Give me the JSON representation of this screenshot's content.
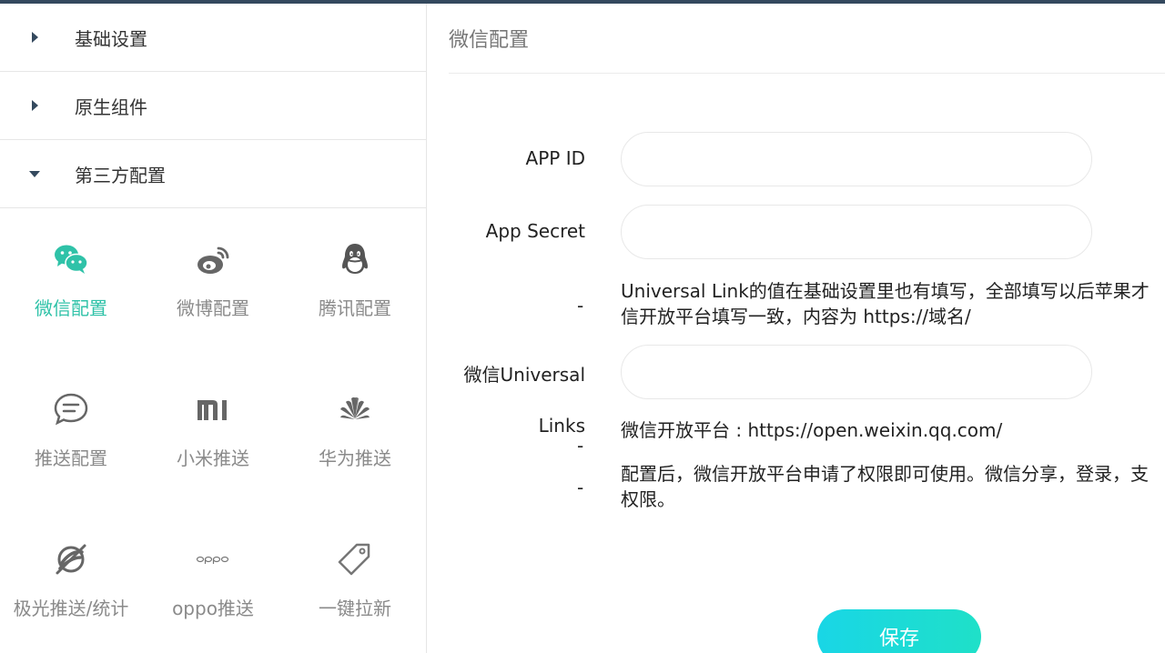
{
  "sidebar": {
    "sections": [
      {
        "label": "基础设置",
        "expanded": false
      },
      {
        "label": "原生组件",
        "expanded": false
      },
      {
        "label": "第三方配置",
        "expanded": true
      }
    ],
    "tiles": [
      {
        "label": "微信配置",
        "icon": "wechat-icon",
        "active": true
      },
      {
        "label": "微博配置",
        "icon": "weibo-icon"
      },
      {
        "label": "腾讯配置",
        "icon": "qq-icon"
      },
      {
        "label": "推送配置",
        "icon": "chat-bubble-icon"
      },
      {
        "label": "小米推送",
        "icon": "xiaomi-icon"
      },
      {
        "label": "华为推送",
        "icon": "huawei-icon"
      },
      {
        "label": "极光推送/统计",
        "icon": "jpush-icon"
      },
      {
        "label": "oppo推送",
        "icon": "oppo-icon"
      },
      {
        "label": "一键拉新",
        "icon": "tag-icon"
      }
    ],
    "active_color": "#2fc2a8"
  },
  "main": {
    "title": "微信配置",
    "fields": {
      "app_id": {
        "label": "APP ID",
        "value": ""
      },
      "app_secret": {
        "label": "App Secret",
        "value": ""
      },
      "universal_note_line1": "Universal Link的值在基础设置里也有填写，全部填写以后苹果才",
      "universal_note_line2": "信开放平台填写一致，内容为 https://域名/",
      "universal_links": {
        "label_line1": "微信Universal",
        "label_line2": "Links",
        "value": ""
      },
      "platform_note": "微信开放平台 : https://open.weixin.qq.com/",
      "usage_note_line1": "配置后，微信开放平台申请了权限即可使用。微信分享，登录，支",
      "usage_note_line2": "权限。"
    },
    "dash": "-",
    "save_label": "保存"
  }
}
